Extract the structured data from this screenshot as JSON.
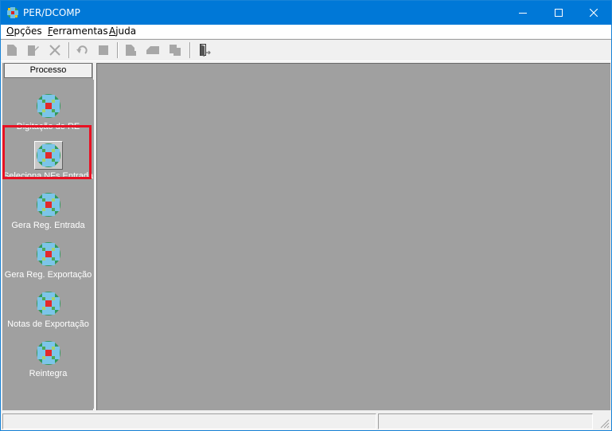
{
  "window": {
    "title": "PER/DCOMP",
    "accent_color": "#0078d7",
    "controls": [
      "minimize-icon",
      "maximize-icon",
      "close-icon"
    ]
  },
  "menu": {
    "items": [
      {
        "label": "Opções",
        "accel": "O",
        "rest": "pções"
      },
      {
        "label": "Ferramentas",
        "accel": "F",
        "rest": "erramentas"
      },
      {
        "label": "Ajuda",
        "accel": "A",
        "rest": "juda"
      }
    ]
  },
  "toolbar": {
    "buttons": [
      "new-icon",
      "edit-icon",
      "delete-icon",
      "undo-icon",
      "save-icon",
      "document-icon",
      "print-icon",
      "copy-icon",
      "exit-door-icon"
    ]
  },
  "sidebar": {
    "header": "Processo",
    "items": [
      {
        "label": "Digitação de RE",
        "icon": "globe-icon",
        "selected": false
      },
      {
        "label": "Seleciona NFs Entrada",
        "icon": "globe-icon",
        "selected": true
      },
      {
        "label": "Gera Reg. Entrada",
        "icon": "globe-icon",
        "selected": false
      },
      {
        "label": "Gera Reg. Exportação",
        "icon": "globe-icon",
        "selected": false
      },
      {
        "label": "Notas de Exportação",
        "icon": "globe-icon",
        "selected": false
      },
      {
        "label": "Reintegra",
        "icon": "globe-icon",
        "selected": false
      }
    ],
    "highlight_color": "#e81123"
  },
  "statusbar": {
    "panels": [
      "",
      ""
    ]
  }
}
